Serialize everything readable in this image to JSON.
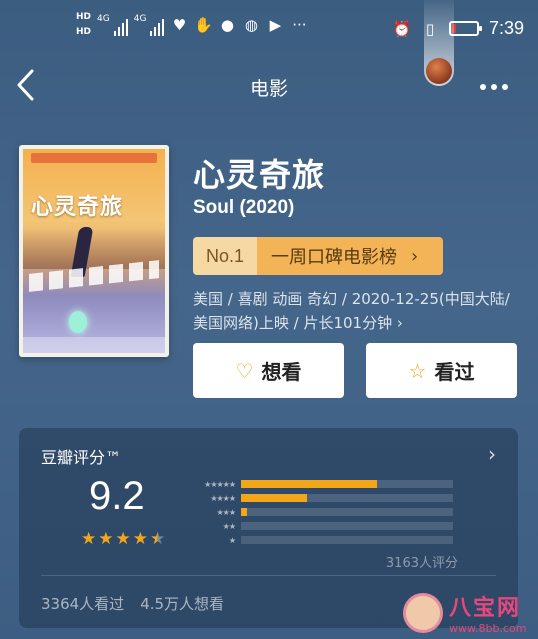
{
  "status_bar": {
    "hd1": "HD",
    "hd2": "HD",
    "net1": "4G",
    "net2": "4G",
    "time": "7:39",
    "battery_level": 0.15,
    "battery_color": "#e23b3b"
  },
  "nav": {
    "title": "电影"
  },
  "movie": {
    "title": "心灵奇旅",
    "original_title": "Soul (2020)",
    "rank": {
      "no": "No.1",
      "name": "一周口碑电影榜",
      "chevron": "›"
    },
    "meta": "美国 / 喜剧 动画 奇幻 / 2020-12-25(中国大陆/美国网络)上映 / 片长101分钟 ›",
    "poster_title": "心灵奇旅"
  },
  "actions": {
    "want": "想看",
    "seen": "看过"
  },
  "rating": {
    "heading": "豆瓣评分™",
    "score": "9.2",
    "stars": 4.5,
    "distribution": [
      {
        "stars": "★★★★★",
        "fraction": 0.64
      },
      {
        "stars": "★★★★",
        "fraction": 0.31
      },
      {
        "stars": "★★★",
        "fraction": 0.03
      },
      {
        "stars": "★★",
        "fraction": 0.0
      },
      {
        "stars": "★",
        "fraction": 0.0
      }
    ],
    "raters": "3163人评分",
    "seen_count": "3364人看过",
    "want_count": "4.5万人想看"
  },
  "watermark": {
    "name": "八宝网",
    "url": "www.8bb.com"
  },
  "colors": {
    "accent": "#f2a71b",
    "background": "#3f6185"
  }
}
